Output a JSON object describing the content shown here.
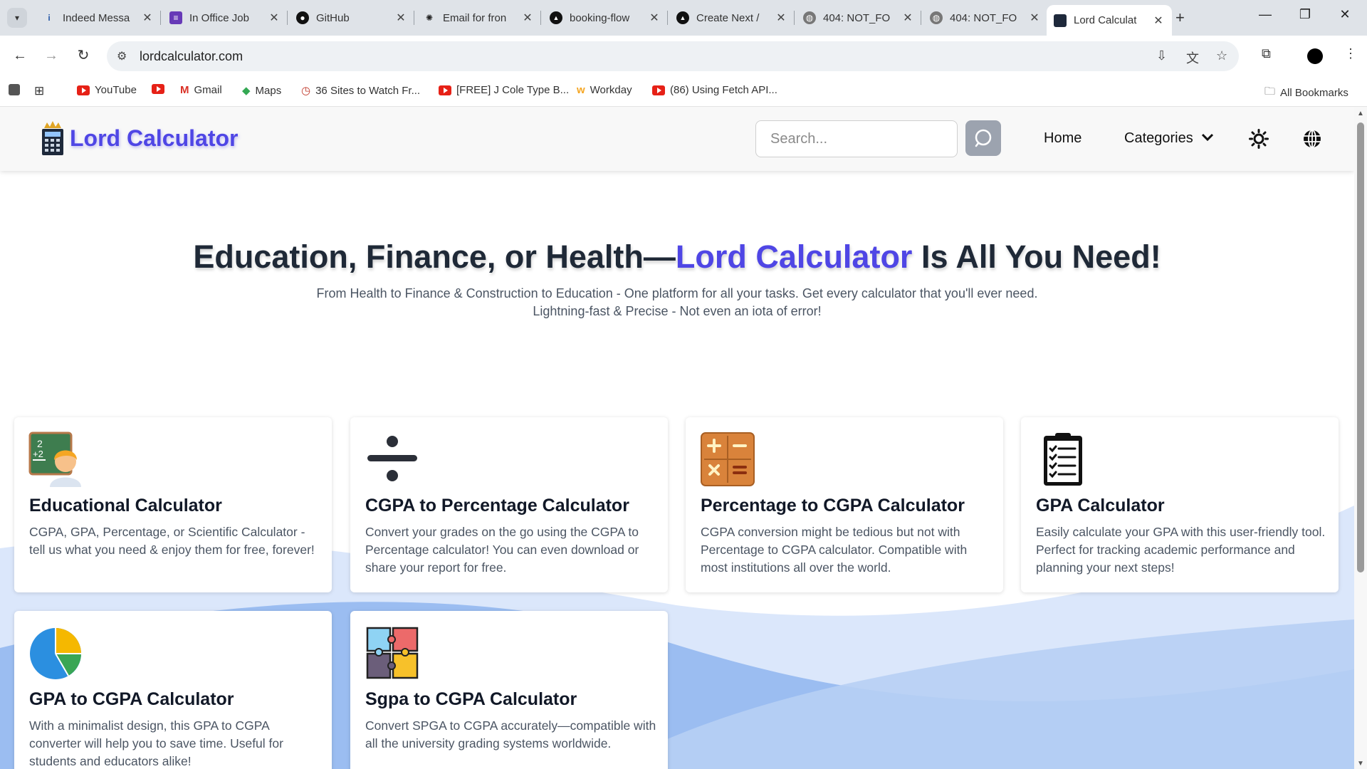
{
  "browser": {
    "tabs": [
      {
        "label": "Indeed Messa",
        "icon": "indeed-icon"
      },
      {
        "label": "In Office Job",
        "icon": "forms-icon"
      },
      {
        "label": "GitHub",
        "icon": "github-icon"
      },
      {
        "label": "Email for fron",
        "icon": "chatgpt-icon"
      },
      {
        "label": "booking-flow",
        "icon": "vercel-icon"
      },
      {
        "label": "Create Next /",
        "icon": "vercel-icon"
      },
      {
        "label": "404: NOT_FO",
        "icon": "globe-icon"
      },
      {
        "label": "404: NOT_FO",
        "icon": "globe-icon"
      },
      {
        "label": "Lord Calculat",
        "icon": "site-icon"
      }
    ],
    "url": "lordcalculator.com",
    "bookmarks": [
      {
        "label": "YouTube"
      },
      {
        "label": ""
      },
      {
        "label": "Gmail"
      },
      {
        "label": "Maps"
      },
      {
        "label": "36 Sites to Watch Fr..."
      },
      {
        "label": "[FREE] J Cole Type B..."
      },
      {
        "label": "Workday"
      },
      {
        "label": "(86) Using Fetch API..."
      }
    ],
    "all_bookmarks": "All Bookmarks"
  },
  "site": {
    "logo_text": "Lord Calculator",
    "search_placeholder": "Search...",
    "nav": {
      "home": "Home",
      "categories": "Categories"
    },
    "brand_color": "#4f46e5"
  },
  "hero": {
    "title_before": "Education, Finance, or Health—",
    "title_accent": "Lord Calculator",
    "title_after": " Is All You Need!",
    "subtitle_line1": "From Health to Finance & Construction to Education - One platform for all your tasks. Get every calculator that you'll ever need.",
    "subtitle_line2": "Lightning-fast & Precise - Not even an iota of error!"
  },
  "cards": [
    {
      "title": "Educational Calculator",
      "desc": "CGPA, GPA, Percentage, or Scientific Calculator - tell us what you need & enjoy them for free, forever!",
      "icon": "teacher-icon"
    },
    {
      "title": "CGPA to Percentage Calculator",
      "desc": "Convert your grades on the go using the CGPA to Percentage calculator! You can even download or share your report for free.",
      "icon": "divide-icon"
    },
    {
      "title": "Percentage to CGPA Calculator",
      "desc": "CGPA conversion might be tedious but not with Percentage to CGPA calculator. Compatible with most institutions all over the world.",
      "icon": "calculator-icon"
    },
    {
      "title": "GPA Calculator",
      "desc": "Easily calculate your GPA with this user-friendly tool. Perfect for tracking academic performance and planning your next steps!",
      "icon": "clipboard-icon"
    },
    {
      "title": "GPA to CGPA Calculator",
      "desc": "With a minimalist design, this GPA to CGPA converter will help you to save time. Useful for students and educators alike!",
      "icon": "pie-chart-icon"
    },
    {
      "title": "Sgpa to CGPA Calculator",
      "desc": "Convert SPGA to CGPA accurately—compatible with all the university grading systems worldwide.",
      "icon": "puzzle-icon"
    }
  ]
}
